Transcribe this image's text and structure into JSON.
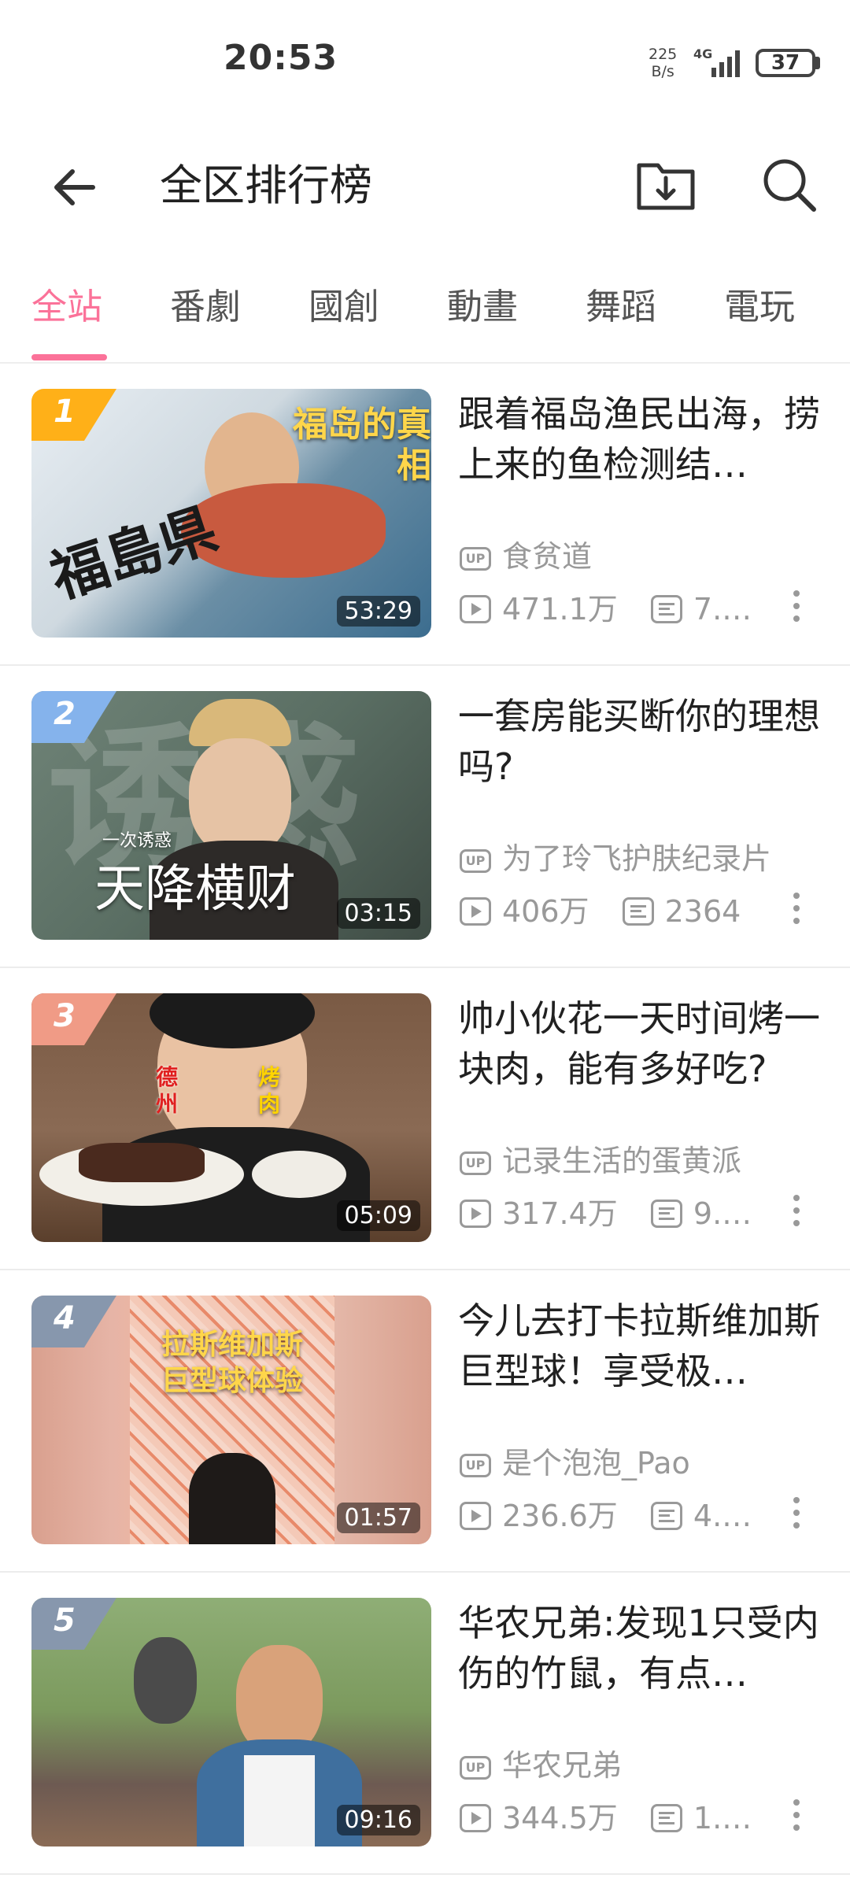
{
  "status_bar": {
    "time": "20:53",
    "net_speed_value": "225",
    "net_speed_unit": "B/s",
    "network": "4G",
    "battery": "37"
  },
  "header": {
    "title": "全区排行榜",
    "back_icon": "arrow-left-icon",
    "download_icon": "download-folder-icon",
    "search_icon": "search-icon"
  },
  "tabs": [
    {
      "label": "全站",
      "active": true
    },
    {
      "label": "番劇",
      "active": false
    },
    {
      "label": "國創",
      "active": false
    },
    {
      "label": "動畫",
      "active": false
    },
    {
      "label": "舞蹈",
      "active": false
    },
    {
      "label": "電玩",
      "active": false
    }
  ],
  "accent_color": "#fb7299",
  "items": [
    {
      "rank": "1",
      "title": "跟着福岛渔民出海，捞上来的鱼检测结…",
      "uploader": "食贫道",
      "views": "471.1万",
      "danmaku": "7.…",
      "duration": "53:29",
      "thumb_caption": "福岛的真相",
      "thumb_caption2": "福島県",
      "rank_color": "#ffb018"
    },
    {
      "rank": "2",
      "title": "一套房能买断你的理想吗?",
      "uploader": "为了玲飞护肤纪录片",
      "views": "406万",
      "danmaku": "2364",
      "duration": "03:15",
      "thumb_caption": "天降横财",
      "thumb_caption2": "一次诱惑",
      "rank_color": "#85b3ec"
    },
    {
      "rank": "3",
      "title": "帅小伙花一天时间烤一块肉，能有多好吃?",
      "uploader": "记录生活的蛋黄派",
      "views": "317.4万",
      "danmaku": "9.…",
      "duration": "05:09",
      "thumb_caption": "德州",
      "thumb_caption2": "烤肉",
      "rank_color": "#f09b86"
    },
    {
      "rank": "4",
      "title": "今儿去打卡拉斯维加斯巨型球！享受极…",
      "uploader": "是个泡泡_Pao",
      "views": "236.6万",
      "danmaku": "4.…",
      "duration": "01:57",
      "thumb_caption": "拉斯维加斯",
      "thumb_caption2": "巨型球体验",
      "rank_color": "#8797ad"
    },
    {
      "rank": "5",
      "title": "华农兄弟:发现1只受内伤的竹鼠，有点…",
      "uploader": "华农兄弟",
      "views": "344.5万",
      "danmaku": "1.…",
      "duration": "09:16",
      "thumb_caption": "",
      "thumb_caption2": "",
      "rank_color": "#8797ad"
    }
  ]
}
